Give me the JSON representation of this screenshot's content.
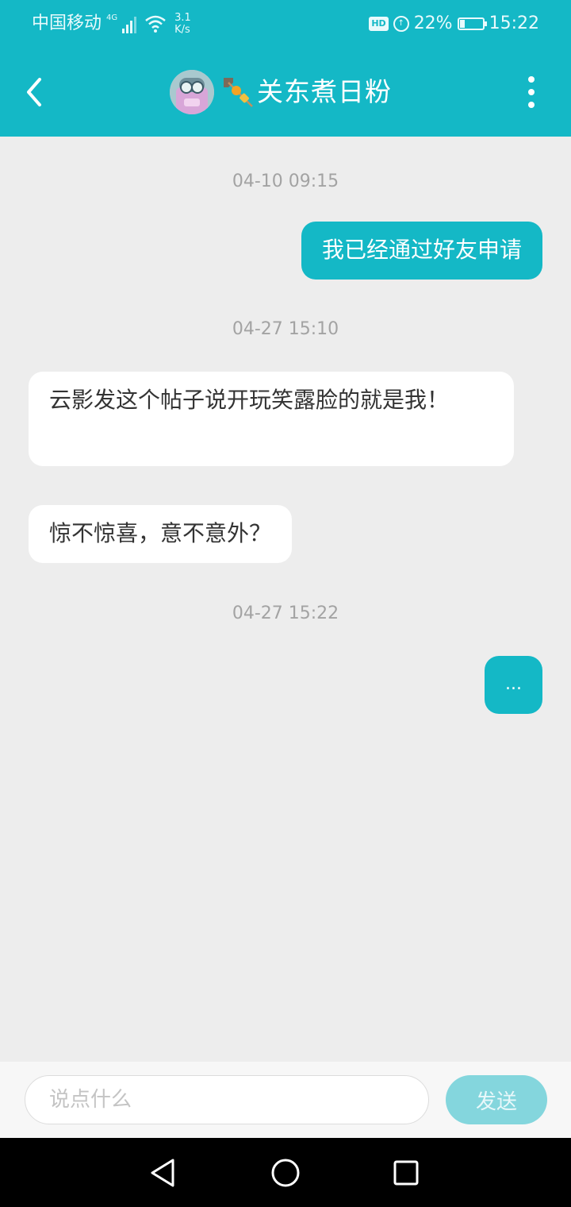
{
  "status_bar": {
    "carrier": "中国移动",
    "network_tag": "4G",
    "speed_value": "3.1",
    "speed_unit": "K/s",
    "hd_label": "HD",
    "battery_percent": "22%",
    "battery_level": 0.22,
    "time": "15:22"
  },
  "header": {
    "title": "关东煮日粉",
    "back_icon": "chevron-left-icon",
    "more_icon": "more-vertical-icon"
  },
  "messages": [
    {
      "type": "timestamp",
      "text": "04-10 09:15"
    },
    {
      "type": "bubble",
      "direction": "out",
      "text": "我已经通过好友申请"
    },
    {
      "type": "timestamp",
      "text": "04-27 15:10"
    },
    {
      "type": "bubble",
      "direction": "in",
      "text": "云影发这个帖子说开玩笑露脸的就是我！"
    },
    {
      "type": "bubble",
      "direction": "in",
      "text": "惊不惊喜，意不意外？"
    },
    {
      "type": "timestamp",
      "text": "04-27 15:22"
    },
    {
      "type": "bubble",
      "direction": "out",
      "text": "..."
    }
  ],
  "input_bar": {
    "placeholder": "说点什么",
    "send_label": "发送"
  },
  "colors": {
    "accent": "#14b8c6",
    "background": "#ededed",
    "send_disabled": "#84d6dd"
  }
}
